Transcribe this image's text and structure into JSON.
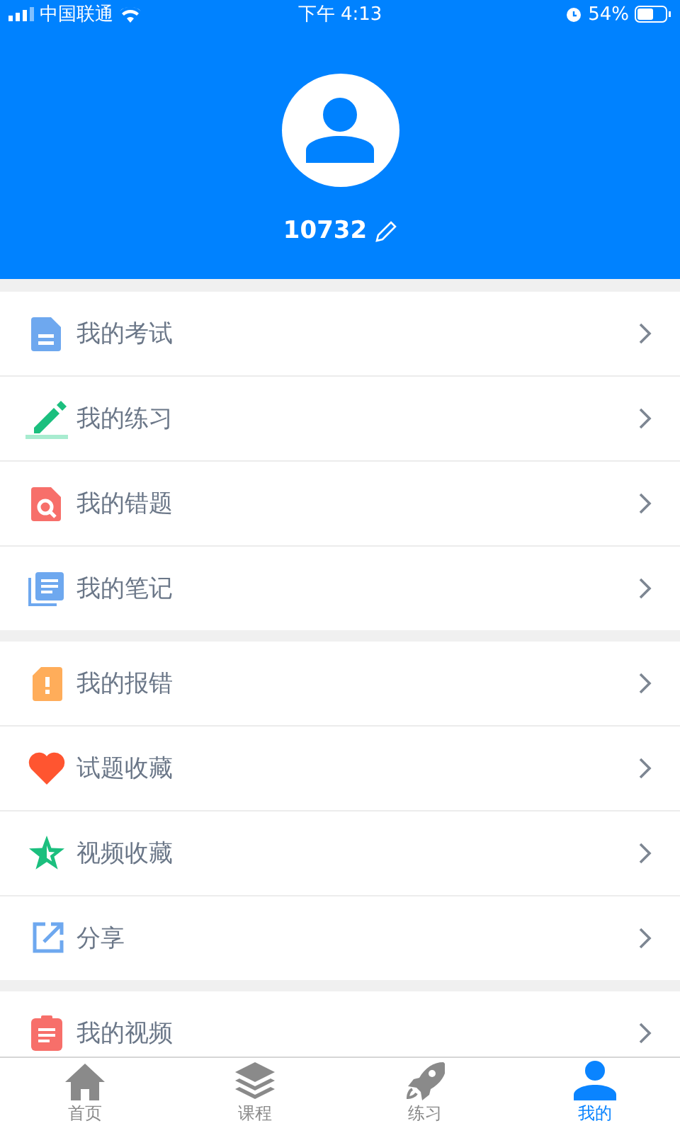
{
  "status_bar": {
    "carrier": "中国联通",
    "time": "下午 4:13",
    "battery": "54%"
  },
  "profile": {
    "username": "10732"
  },
  "sections": [
    {
      "items": [
        {
          "kind": "doc",
          "label": "我的考试"
        },
        {
          "kind": "pencil",
          "label": "我的练习"
        },
        {
          "kind": "search",
          "label": "我的错题"
        },
        {
          "kind": "notes",
          "label": "我的笔记"
        }
      ]
    },
    {
      "items": [
        {
          "kind": "alert",
          "label": "我的报错"
        },
        {
          "kind": "heart",
          "label": "试题收藏"
        },
        {
          "kind": "star",
          "label": "视频收藏"
        },
        {
          "kind": "share",
          "label": "分享"
        }
      ]
    },
    {
      "items": [
        {
          "kind": "clipboard",
          "label": "我的视频"
        }
      ]
    }
  ],
  "tabs": [
    {
      "kind": "home",
      "label": "首页",
      "selected": false
    },
    {
      "kind": "layers",
      "label": "课程",
      "selected": false
    },
    {
      "kind": "rocket",
      "label": "练习",
      "selected": false
    },
    {
      "kind": "person",
      "label": "我的",
      "selected": true
    }
  ]
}
